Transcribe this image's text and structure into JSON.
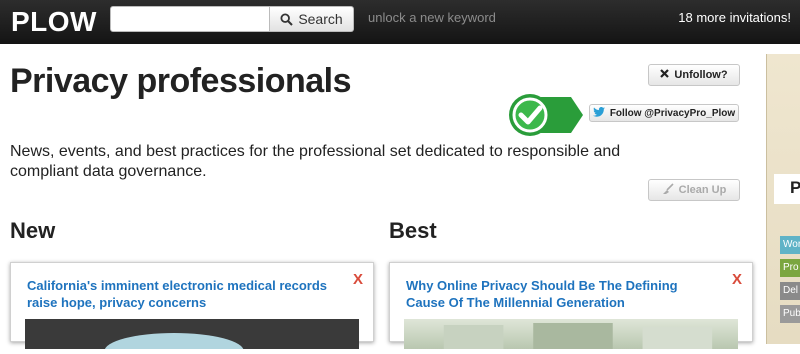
{
  "app": {
    "logo": "PLOW",
    "tagline": "unlock a new keyword",
    "invitations": "18 more invitations!"
  },
  "search": {
    "placeholder": "",
    "button_label": "Search",
    "button_icon": "magnifier-icon"
  },
  "topic": {
    "title": "Privacy professionals",
    "description": "News, events, and best practices for the professional set dedicated to responsible and compliant data governance.",
    "unfollow_label": "Unfollow?",
    "twitter_label": "Follow @PrivacyPro_Plow",
    "cleanup_label": "Clean Up",
    "checkmark_color": "#2a9d3a"
  },
  "sections": {
    "new": {
      "title": "New",
      "card": {
        "headline": "California's imminent electronic medical records raise hope, privacy concerns",
        "close": "X"
      }
    },
    "best": {
      "title": "Best",
      "card": {
        "headline": "Why Online Privacy Should Be The Defining Cause Of The Millennial Generation",
        "close": "X"
      }
    }
  },
  "side_panel": {
    "letter": "P",
    "rows": [
      "Wor",
      "Pro",
      "Del",
      "Pub"
    ]
  },
  "colors": {
    "link": "#1e73be",
    "close": "#d94b3b",
    "topbar": "#1f1f1f"
  }
}
